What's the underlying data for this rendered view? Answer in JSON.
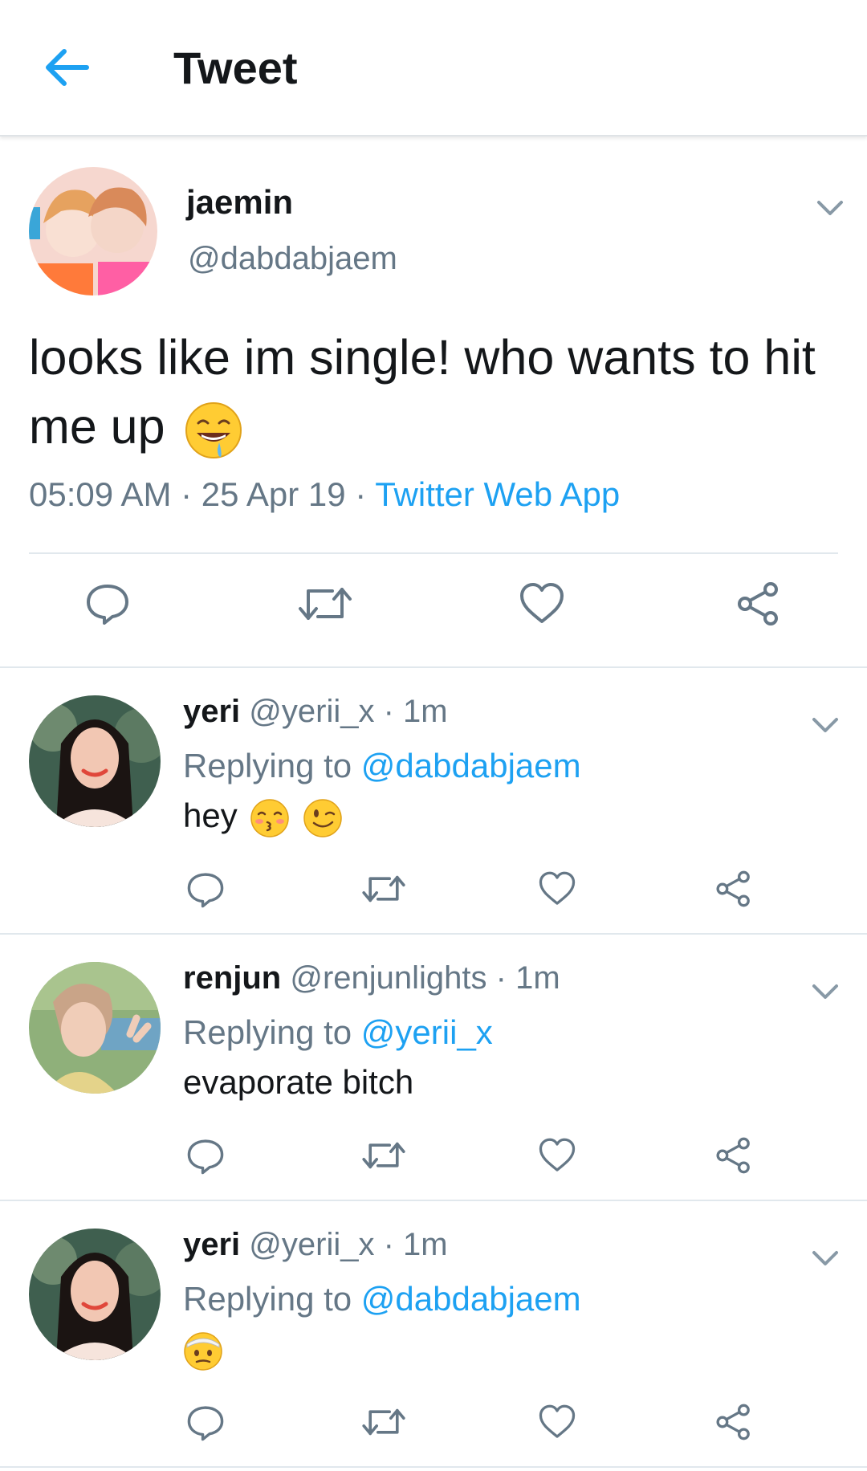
{
  "header": {
    "title": "Tweet",
    "back_icon": "arrow-left-icon",
    "accent": "#1da1f2"
  },
  "main_tweet": {
    "author_name": "jaemin",
    "author_handle": "@dabdabjaem",
    "text": "looks like im single! who wants to hit me up",
    "emoji": "drooling-face-emoji",
    "time": "05:09 AM",
    "date": "25 Apr 19",
    "source": "Twitter Web App",
    "separator": " · "
  },
  "replies": [
    {
      "name": "yeri",
      "handle": "@yerii_x",
      "time": "1m",
      "replying_prefix": "Replying to ",
      "replying_to": "@dabdabjaem",
      "text": "hey",
      "emojis": [
        "kissing-face-emoji",
        "winking-face-emoji"
      ]
    },
    {
      "name": "renjun",
      "handle": "@renjunlights",
      "time": "1m",
      "replying_prefix": "Replying to ",
      "replying_to": "@yerii_x",
      "text": "evaporate bitch",
      "emojis": []
    },
    {
      "name": "yeri",
      "handle": "@yerii_x",
      "time": "1m",
      "replying_prefix": "Replying to ",
      "replying_to": "@dabdabjaem",
      "text": "",
      "emojis": [
        "face-with-head-bandage-emoji"
      ]
    }
  ],
  "colors": {
    "text": "#14171a",
    "secondary": "#657786",
    "link": "#1da1f2",
    "divider": "#e1e8ed"
  }
}
